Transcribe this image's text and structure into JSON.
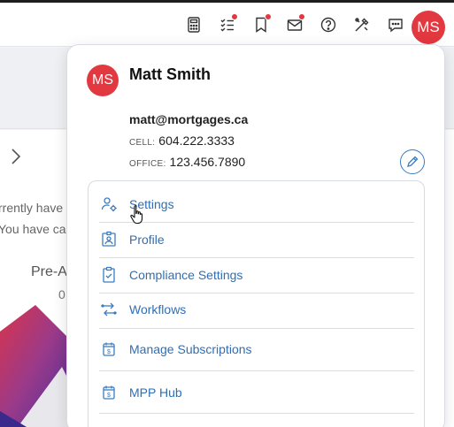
{
  "header": {
    "avatar_initials": "MS",
    "icons": [
      "calculator-icon",
      "checklist-icon",
      "bookmark-icon",
      "mail-icon",
      "help-icon",
      "tools-icon",
      "chat-icon"
    ],
    "notification_color": "#e2383f"
  },
  "background_page": {
    "line1": "rrently have",
    "line2": "You have car",
    "label": "Pre-A",
    "value": "0"
  },
  "profile": {
    "avatar_initials": "MS",
    "name": "Matt Smith",
    "email": "matt@mortgages.ca",
    "cell_label": "CELL:",
    "cell_value": "604.222.3333",
    "office_label": "OFFICE:",
    "office_value": "123.456.7890"
  },
  "menu": {
    "items": [
      {
        "label": "Settings",
        "icon": "user-settings-icon"
      },
      {
        "label": "Profile",
        "icon": "id-badge-icon"
      },
      {
        "label": "Compliance Settings",
        "icon": "clipboard-check-icon"
      },
      {
        "label": "Workflows",
        "icon": "workflow-icon"
      },
      {
        "label": "Manage Subscriptions",
        "icon": "subscription-icon"
      },
      {
        "label": "MPP Hub",
        "icon": "hub-icon"
      }
    ]
  },
  "colors": {
    "accent": "#2f6eb5",
    "brand_red": "#e2383f"
  }
}
